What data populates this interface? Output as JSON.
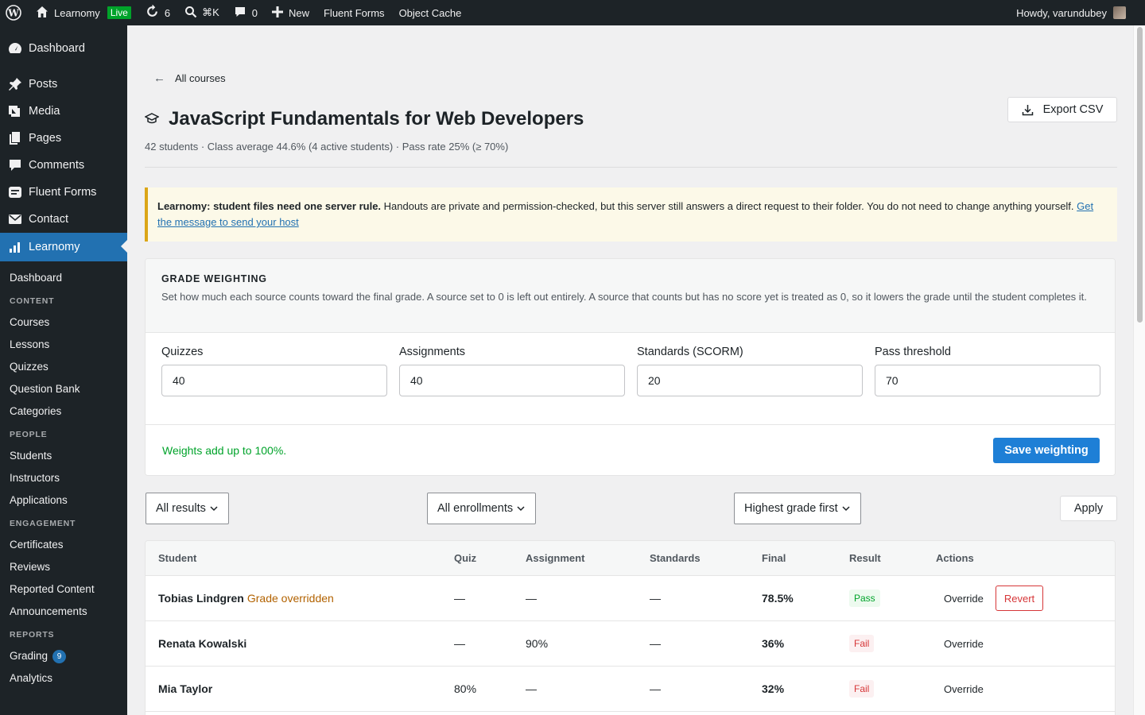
{
  "adminbar": {
    "site_name": "Learnomy",
    "live_label": "Live",
    "updates_count": "6",
    "search_shortcut": "⌘K",
    "comments_count": "0",
    "new_label": "New",
    "fluent_forms_label": "Fluent Forms",
    "object_cache_label": "Object Cache",
    "howdy": "Howdy, varundubey"
  },
  "sidebar": {
    "top_items": [
      {
        "label": "Dashboard",
        "icon": "dashboard-icon"
      },
      {
        "label": "Posts",
        "icon": "pin-icon"
      },
      {
        "label": "Media",
        "icon": "media-icon"
      },
      {
        "label": "Pages",
        "icon": "pages-icon"
      },
      {
        "label": "Comments",
        "icon": "comment-icon"
      },
      {
        "label": "Fluent Forms",
        "icon": "forms-icon"
      },
      {
        "label": "Contact",
        "icon": "envelope-icon"
      },
      {
        "label": "Learnomy",
        "icon": "chart-icon"
      }
    ],
    "sub_dashboard": "Dashboard",
    "head_content": "CONTENT",
    "courses": "Courses",
    "lessons": "Lessons",
    "quizzes": "Quizzes",
    "question_bank": "Question Bank",
    "categories": "Categories",
    "head_people": "PEOPLE",
    "students": "Students",
    "instructors": "Instructors",
    "applications": "Applications",
    "head_engagement": "ENGAGEMENT",
    "certificates": "Certificates",
    "reviews": "Reviews",
    "reported_content": "Reported Content",
    "announcements": "Announcements",
    "head_reports": "REPORTS",
    "grading": "Grading",
    "grading_badge": "9",
    "analytics": "Analytics"
  },
  "page": {
    "back_label": "All courses",
    "title": "JavaScript Fundamentals for Web Developers",
    "export_label": "Export CSV",
    "subtitle": "42 students · Class average 44.6% (4 active students) · Pass rate 25% (≥ 70%)"
  },
  "notice": {
    "bold": "Learnomy: student files need one server rule.",
    "text": " Handouts are private and permission-checked, but this server still answers a direct request to their folder. You do not need to change anything yourself. ",
    "link": "Get the message to send your host"
  },
  "weighting": {
    "heading": "GRADE WEIGHTING",
    "description": "Set how much each source counts toward the final grade. A source set to 0 is left out entirely. A source that counts but has no score yet is treated as 0, so it lowers the grade until the student completes it.",
    "fields": [
      {
        "label": "Quizzes",
        "value": "40"
      },
      {
        "label": "Assignments",
        "value": "40"
      },
      {
        "label": "Standards (SCORM)",
        "value": "20"
      },
      {
        "label": "Pass threshold",
        "value": "70"
      }
    ],
    "status": "Weights add up to 100%.",
    "save_label": "Save weighting"
  },
  "filters": {
    "results": "All results",
    "enrollments": "All enrollments",
    "sort": "Highest grade first",
    "apply": "Apply"
  },
  "table": {
    "headers": {
      "student": "Student",
      "quiz": "Quiz",
      "assignment": "Assignment",
      "standards": "Standards",
      "final": "Final",
      "result": "Result",
      "actions": "Actions"
    },
    "rows": [
      {
        "name": "Tobias Lindgren",
        "note": "Grade overridden",
        "quiz": "—",
        "assignment": "—",
        "standards": "—",
        "final": "78.5%",
        "result": "Pass",
        "override": "Override",
        "revert": "Revert"
      },
      {
        "name": "Renata Kowalski",
        "note": "",
        "quiz": "—",
        "assignment": "90%",
        "standards": "—",
        "final": "36%",
        "result": "Fail",
        "override": "Override",
        "revert": ""
      },
      {
        "name": "Mia Taylor",
        "note": "",
        "quiz": "80%",
        "assignment": "—",
        "standards": "—",
        "final": "32%",
        "result": "Fail",
        "override": "Override",
        "revert": ""
      }
    ]
  },
  "colors": {
    "admin_bg": "#1d2327",
    "accent": "#2271b1",
    "pass": "#00a32a",
    "fail": "#d63638",
    "warning": "#dba617",
    "override_note": "#b26200"
  }
}
